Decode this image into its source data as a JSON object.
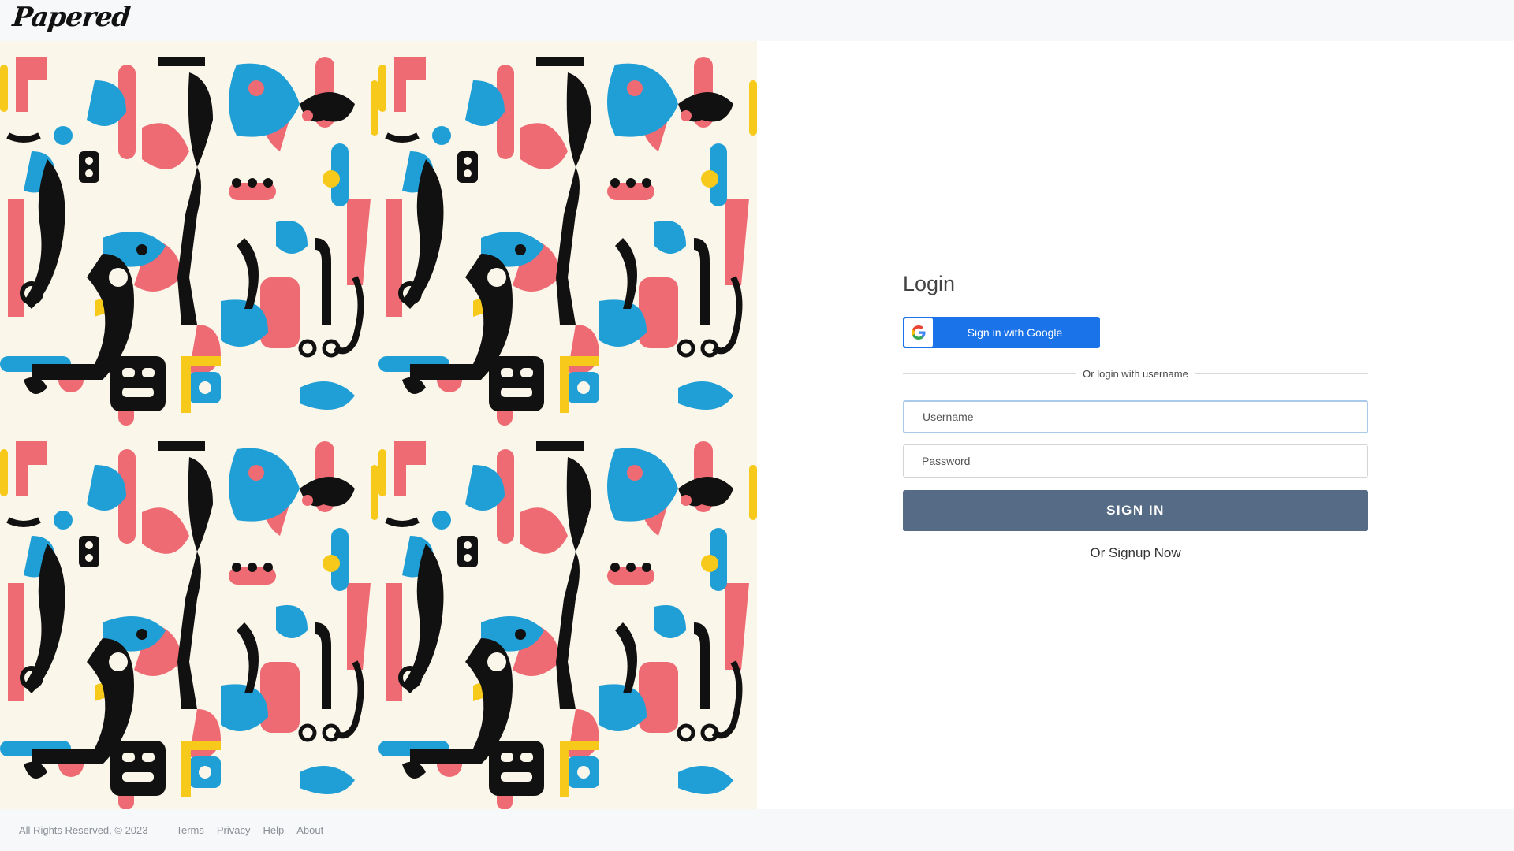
{
  "header": {
    "logo_text": "Papered"
  },
  "hero": {
    "pattern_colors": {
      "pink": "#ee6b74",
      "blue": "#1f9fd6",
      "yellow": "#f7c91a",
      "black": "#111111",
      "cream": "#fbf6ea"
    }
  },
  "login": {
    "title": "Login",
    "google_button_label": "Sign in with Google",
    "divider_text": "Or login with username",
    "username_placeholder": "Username",
    "password_placeholder": "Password",
    "signin_label": "SIGN IN",
    "signup_label": "Or Signup Now"
  },
  "footer": {
    "copyright": "All Rights Reserved, © 2023",
    "links": [
      "Terms",
      "Privacy",
      "Help",
      "About"
    ]
  },
  "colors": {
    "google_blue": "#1a73e8",
    "signin_button": "#566c86",
    "header_bg": "#f7f8fa"
  }
}
